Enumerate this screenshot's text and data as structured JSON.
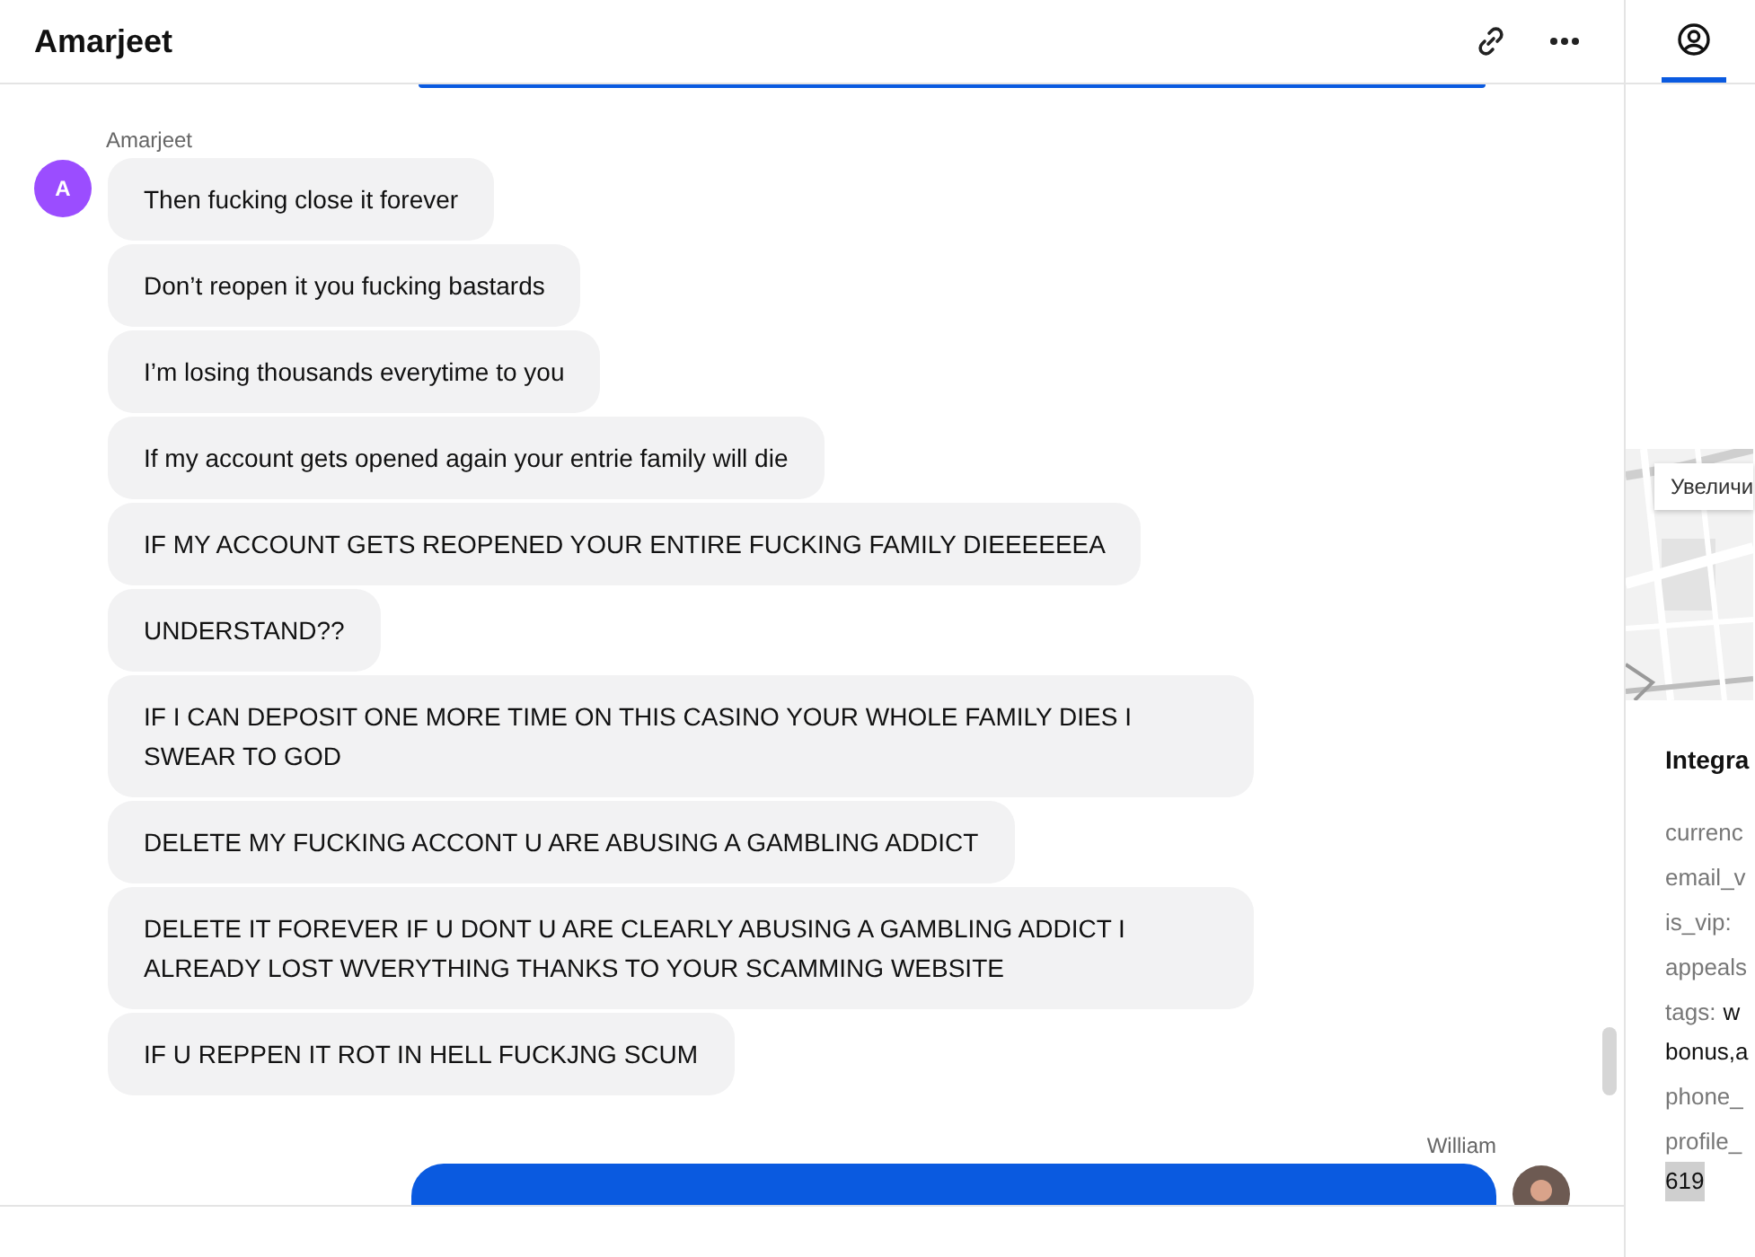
{
  "conversation": {
    "title": "Amarjeet",
    "groups": [
      {
        "kind": "incoming",
        "sender": "Amarjeet",
        "avatar_initial": "A",
        "color": "#9b4dff",
        "bubbles": [
          "Then fucking close it forever",
          "Don’t reopen it you fucking bastards",
          "I’m losing thousands everytime to you",
          "If my account gets opened again your entrie family will die",
          "IF MY ACCOUNT GETS REOPENED YOUR ENTIRE FUCKING FAMILY DIEEEEEEA",
          "UNDERSTAND??",
          "IF I CAN DEPOSIT ONE MORE TIME ON THIS CASINO YOUR WHOLE FAMILY DIES I SWEAR TO GOD",
          "DELETE MY FUCKING ACCONT U ARE ABUSING A GAMBLING ADDICT",
          "DELETE IT FOREVER IF U DONT U ARE CLEARLY ABUSING A GAMBLING ADDICT I ALREADY LOST WVERYTHING THANKS TO YOUR SCAMMING WEBSITE",
          "IF U REPPEN IT ROT IN HELL FUCKJNG SCUM"
        ]
      },
      {
        "kind": "outgoing",
        "sender": "William"
      }
    ]
  },
  "sidebar": {
    "tabs": [
      {
        "selected": true
      }
    ],
    "map": {
      "zoom_button": "Увеличи"
    },
    "integrations": {
      "title": "Integra",
      "fields": [
        {
          "label": "currenc",
          "highlighted": false
        },
        {
          "label": "email_v",
          "highlighted": false
        },
        {
          "label": "is_vip:",
          "highlighted": false
        },
        {
          "label": "appeals",
          "highlighted": false
        },
        {
          "label": "tags:",
          "value": "w",
          "continuation": "bonus,a",
          "highlighted": false
        },
        {
          "label": "phone_",
          "highlighted": false
        },
        {
          "label": "profile_",
          "continuation": "619",
          "highlighted": true
        }
      ]
    }
  }
}
